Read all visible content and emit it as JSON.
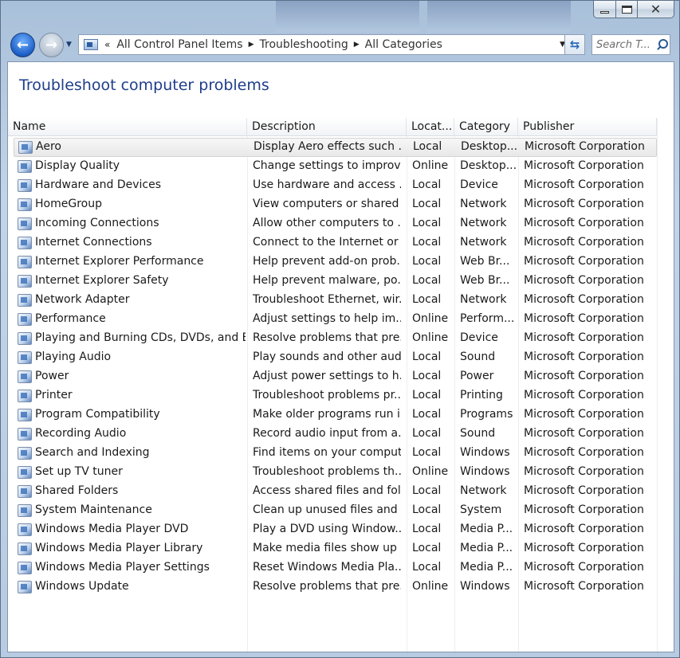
{
  "window": {
    "controls": {
      "minimize": "minimize",
      "maximize": "maximize",
      "close": "✕"
    }
  },
  "nav": {
    "breadcrumb_overflow": "«",
    "breadcrumb": [
      "All Control Panel Items",
      "Troubleshooting",
      "All Categories"
    ],
    "search_placeholder": "Search T..."
  },
  "page": {
    "title": "Troubleshoot computer problems"
  },
  "columns": [
    "Name",
    "Description",
    "Locat...",
    "Category",
    "Publisher"
  ],
  "rows": [
    {
      "name": "Aero",
      "description": "Display Aero effects such ...",
      "location": "Local",
      "category": "Desktop...",
      "publisher": "Microsoft Corporation",
      "selected": true
    },
    {
      "name": "Display Quality",
      "description": "Change settings to improv...",
      "location": "Online",
      "category": "Desktop...",
      "publisher": "Microsoft Corporation"
    },
    {
      "name": "Hardware and Devices",
      "description": "Use hardware and access ...",
      "location": "Local",
      "category": "Device",
      "publisher": "Microsoft Corporation"
    },
    {
      "name": "HomeGroup",
      "description": "View computers or shared ...",
      "location": "Local",
      "category": "Network",
      "publisher": "Microsoft Corporation"
    },
    {
      "name": "Incoming Connections",
      "description": "Allow other computers to ...",
      "location": "Local",
      "category": "Network",
      "publisher": "Microsoft Corporation"
    },
    {
      "name": "Internet Connections",
      "description": "Connect to the Internet or ...",
      "location": "Local",
      "category": "Network",
      "publisher": "Microsoft Corporation"
    },
    {
      "name": "Internet Explorer Performance",
      "description": "Help prevent add-on prob...",
      "location": "Local",
      "category": "Web Br...",
      "publisher": "Microsoft Corporation"
    },
    {
      "name": "Internet Explorer Safety",
      "description": "Help prevent malware, po...",
      "location": "Local",
      "category": "Web Br...",
      "publisher": "Microsoft Corporation"
    },
    {
      "name": "Network Adapter",
      "description": "Troubleshoot Ethernet, wir...",
      "location": "Local",
      "category": "Network",
      "publisher": "Microsoft Corporation"
    },
    {
      "name": "Performance",
      "description": "Adjust settings to help im...",
      "location": "Online",
      "category": "Perform...",
      "publisher": "Microsoft Corporation"
    },
    {
      "name": "Playing and Burning CDs, DVDs, and B...",
      "description": "Resolve problems that pre...",
      "location": "Online",
      "category": "Device",
      "publisher": "Microsoft Corporation"
    },
    {
      "name": "Playing Audio",
      "description": "Play sounds and other aud...",
      "location": "Local",
      "category": "Sound",
      "publisher": "Microsoft Corporation"
    },
    {
      "name": "Power",
      "description": "Adjust power settings to h...",
      "location": "Local",
      "category": "Power",
      "publisher": "Microsoft Corporation"
    },
    {
      "name": "Printer",
      "description": "Troubleshoot problems pr...",
      "location": "Local",
      "category": "Printing",
      "publisher": "Microsoft Corporation"
    },
    {
      "name": "Program Compatibility",
      "description": "Make older programs run i...",
      "location": "Local",
      "category": "Programs",
      "publisher": "Microsoft Corporation"
    },
    {
      "name": "Recording Audio",
      "description": "Record audio input from a...",
      "location": "Local",
      "category": "Sound",
      "publisher": "Microsoft Corporation"
    },
    {
      "name": "Search and Indexing",
      "description": "Find items on your comput...",
      "location": "Local",
      "category": "Windows",
      "publisher": "Microsoft Corporation"
    },
    {
      "name": "Set up TV tuner",
      "description": "Troubleshoot problems th...",
      "location": "Online",
      "category": "Windows",
      "publisher": "Microsoft Corporation"
    },
    {
      "name": "Shared Folders",
      "description": "Access shared files and fol...",
      "location": "Local",
      "category": "Network",
      "publisher": "Microsoft Corporation"
    },
    {
      "name": "System Maintenance",
      "description": "Clean up unused files and ...",
      "location": "Local",
      "category": "System",
      "publisher": "Microsoft Corporation"
    },
    {
      "name": "Windows Media Player DVD",
      "description": "Play a DVD using Window...",
      "location": "Local",
      "category": "Media P...",
      "publisher": "Microsoft Corporation"
    },
    {
      "name": "Windows Media Player Library",
      "description": "Make media files show up ...",
      "location": "Local",
      "category": "Media P...",
      "publisher": "Microsoft Corporation"
    },
    {
      "name": "Windows Media Player Settings",
      "description": "Reset Windows Media Pla...",
      "location": "Local",
      "category": "Media P...",
      "publisher": "Microsoft Corporation"
    },
    {
      "name": "Windows Update",
      "description": "Resolve problems that pre...",
      "location": "Online",
      "category": "Windows",
      "publisher": "Microsoft Corporation"
    }
  ]
}
